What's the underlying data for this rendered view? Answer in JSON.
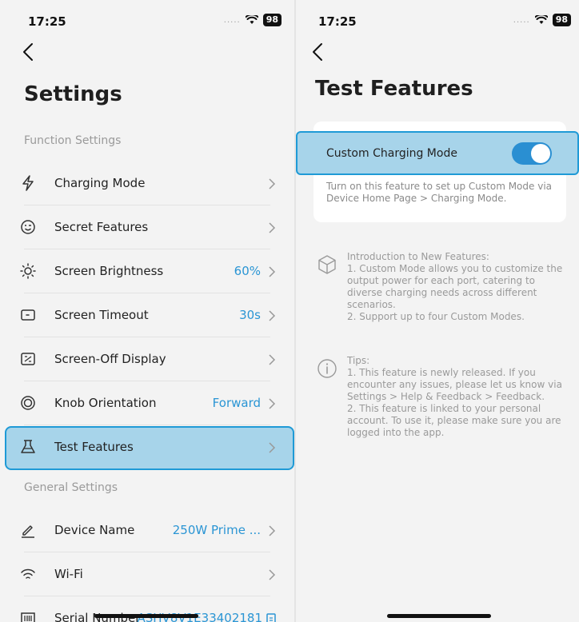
{
  "left": {
    "status": {
      "time": "17:25",
      "signal": ".....",
      "battery": "98"
    },
    "title": "Settings",
    "function_section": "Function Settings",
    "function_items": [
      {
        "label": "Charging Mode",
        "value": ""
      },
      {
        "label": "Secret Features",
        "value": ""
      },
      {
        "label": "Screen Brightness",
        "value": "60%"
      },
      {
        "label": "Screen Timeout",
        "value": "30s"
      },
      {
        "label": "Screen-Off Display",
        "value": ""
      },
      {
        "label": "Knob Orientation",
        "value": "Forward"
      },
      {
        "label": "Test Features",
        "value": ""
      }
    ],
    "general_section": "General Settings",
    "general_items": [
      {
        "label": "Device Name",
        "value": "250W Prime ..."
      },
      {
        "label": "Wi-Fi",
        "value": ""
      },
      {
        "label": "Serial Number",
        "value": "ASHV8V1E33402181"
      }
    ]
  },
  "right": {
    "status": {
      "time": "17:25",
      "signal": ".....",
      "battery": "98"
    },
    "title": "Test Features",
    "toggle": {
      "label": "Custom Charging Mode",
      "enabled": true,
      "description": "Turn on this feature to set up Custom Mode via Device Home Page > Charging Mode."
    },
    "intro": {
      "heading": "Introduction to New Features:",
      "line1": "1. Custom Mode allows you to customize the output power for each port, catering to diverse charging needs across different scenarios.",
      "line2": "2. Support up to four Custom Modes."
    },
    "tips": {
      "heading": "Tips:",
      "line1": "1. This feature is newly released. If you encounter any issues, please let us know via Settings > Help & Feedback > Feedback.",
      "line2": "2. This feature is linked to your personal account. To use it, please make sure you are logged into the app."
    }
  },
  "colors": {
    "accent": "#2a95d4",
    "highlight": "#a7d4ea",
    "highlight_border": "#1f9ad6"
  }
}
